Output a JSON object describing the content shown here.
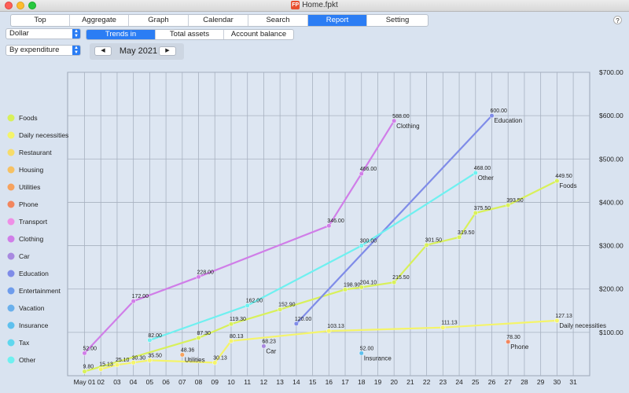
{
  "window": {
    "title": "Home.fpkt",
    "app_icon": "FP",
    "help_label": "?"
  },
  "tabs": [
    {
      "label": "Top"
    },
    {
      "label": "Aggregate"
    },
    {
      "label": "Graph"
    },
    {
      "label": "Calendar"
    },
    {
      "label": "Search"
    },
    {
      "label": "Report",
      "active": true
    },
    {
      "label": "Setting"
    }
  ],
  "currency_select": {
    "value": "Dollar"
  },
  "mode_select": {
    "value": "By expenditure"
  },
  "report_tabs": [
    {
      "label": "Trends in expenditure",
      "active": true
    },
    {
      "label": "Total assets"
    },
    {
      "label": "Account balance"
    }
  ],
  "month_nav": {
    "label": "May 2021",
    "prev": "◀",
    "next": "▶"
  },
  "chart_data": {
    "type": "line",
    "x_categories": [
      "May 01",
      "02",
      "03",
      "04",
      "05",
      "06",
      "07",
      "08",
      "09",
      "10",
      "11",
      "12",
      "13",
      "14",
      "15",
      "16",
      "17",
      "18",
      "19",
      "20",
      "21",
      "22",
      "23",
      "24",
      "25",
      "26",
      "27",
      "28",
      "29",
      "30",
      "31"
    ],
    "y_ticks": [
      "$100.00",
      "$200.00",
      "$300.00",
      "$400.00",
      "$500.00",
      "$600.00",
      "$700.00"
    ],
    "ylim": [
      0,
      700
    ],
    "grid": true,
    "legend_position": "left",
    "legend": [
      {
        "name": "Foods",
        "color": "#d8f05a"
      },
      {
        "name": "Daily necessities",
        "color": "#f4f46a"
      },
      {
        "name": "Restaurant",
        "color": "#f6dc6a"
      },
      {
        "name": "Housing",
        "color": "#f6c163"
      },
      {
        "name": "Utilities",
        "color": "#f6a25e"
      },
      {
        "name": "Phone",
        "color": "#f2865e"
      },
      {
        "name": "Transport",
        "color": "#ef8fe6"
      },
      {
        "name": "Clothing",
        "color": "#d07ee8"
      },
      {
        "name": "Car",
        "color": "#a889e0"
      },
      {
        "name": "Education",
        "color": "#7f8ce8"
      },
      {
        "name": "Entertainment",
        "color": "#6e9cec"
      },
      {
        "name": "Vacation",
        "color": "#6ab0ec"
      },
      {
        "name": "Insurance",
        "color": "#5ec0ee"
      },
      {
        "name": "Tax",
        "color": "#5fd7ee"
      },
      {
        "name": "Other",
        "color": "#6ff0f0"
      }
    ],
    "series": [
      {
        "name": "Foods",
        "color": "#d8f05a",
        "points": [
          {
            "x": 1,
            "y": 9.8,
            "label": "9.80"
          },
          {
            "x": 8,
            "y": 87.3,
            "label": "87.30"
          },
          {
            "x": 10,
            "y": 119.3,
            "label": "119.30"
          },
          {
            "x": 13,
            "y": 152.9,
            "label": "152.90"
          },
          {
            "x": 17,
            "y": 198.9,
            "label": "198.90"
          },
          {
            "x": 18,
            "y": 204.1,
            "label": "204.10"
          },
          {
            "x": 20,
            "y": 215.5,
            "label": "215.50"
          },
          {
            "x": 22,
            "y": 301.5,
            "label": "301.50"
          },
          {
            "x": 24,
            "y": 319.5,
            "label": "319.50"
          },
          {
            "x": 25,
            "y": 375.5,
            "label": "375.50"
          },
          {
            "x": 27,
            "y": 393.5,
            "label": "393.50"
          },
          {
            "x": 30,
            "y": 449.5,
            "label": "449.50"
          }
        ]
      },
      {
        "name": "Daily necessities",
        "color": "#f4f46a",
        "points": [
          {
            "x": 2,
            "y": 15.13,
            "label": "15.13"
          },
          {
            "x": 3,
            "y": 25.1,
            "label": "25.10"
          },
          {
            "x": 4,
            "y": 30.3,
            "label": "30.30"
          },
          {
            "x": 5,
            "y": 35.5,
            "label": "35.50"
          },
          {
            "x": 9,
            "y": 30.13,
            "label": "30.13"
          },
          {
            "x": 10,
            "y": 80.13,
            "label": "80.13"
          },
          {
            "x": 16,
            "y": 103.13,
            "label": "103.13"
          },
          {
            "x": 23,
            "y": 111.13,
            "label": "111.13"
          },
          {
            "x": 30,
            "y": 127.13,
            "label": "127.13"
          }
        ]
      },
      {
        "name": "Utilities",
        "color": "#f6a25e",
        "points": [
          {
            "x": 7,
            "y": 48.36,
            "label": "48.36"
          }
        ]
      },
      {
        "name": "Phone",
        "color": "#f2865e",
        "points": [
          {
            "x": 27,
            "y": 78.3,
            "label": "78.30"
          }
        ]
      },
      {
        "name": "Clothing",
        "color": "#d07ee8",
        "points": [
          {
            "x": 1,
            "y": 52.0,
            "label": "52.00"
          },
          {
            "x": 4,
            "y": 172.0,
            "label": "172.00"
          },
          {
            "x": 8,
            "y": 228.0,
            "label": "228.00"
          },
          {
            "x": 16,
            "y": 346.0,
            "label": "346.00"
          },
          {
            "x": 18,
            "y": 466.0,
            "label": "466.00"
          },
          {
            "x": 20,
            "y": 588.0,
            "label": "588.00"
          }
        ]
      },
      {
        "name": "Car",
        "color": "#a889e0",
        "points": [
          {
            "x": 12,
            "y": 68.23,
            "label": "68.23"
          }
        ]
      },
      {
        "name": "Education",
        "color": "#7f8ce8",
        "points": [
          {
            "x": 14,
            "y": 120.0,
            "label": "120.00"
          },
          {
            "x": 26,
            "y": 600.0,
            "label": "600.00"
          }
        ]
      },
      {
        "name": "Insurance",
        "color": "#5ec0ee",
        "points": [
          {
            "x": 18,
            "y": 52.0,
            "label": "52.00"
          }
        ]
      },
      {
        "name": "Other",
        "color": "#6ff0f0",
        "points": [
          {
            "x": 5,
            "y": 82.0,
            "label": "82.00"
          },
          {
            "x": 11,
            "y": 162.0,
            "label": "162.00"
          },
          {
            "x": 18,
            "y": 300.0,
            "label": "300.00"
          },
          {
            "x": 25,
            "y": 468.0,
            "label": "468.00"
          }
        ]
      }
    ],
    "end_labels": [
      {
        "series": "Clothing",
        "text": "Clothing"
      },
      {
        "series": "Education",
        "text": "Education"
      },
      {
        "series": "Other",
        "text": "Other"
      },
      {
        "series": "Foods",
        "text": "Foods"
      },
      {
        "series": "Daily necessities",
        "text": "Daily necessities"
      },
      {
        "series": "Utilities",
        "text": "Utilities"
      },
      {
        "series": "Phone",
        "text": "Phone"
      },
      {
        "series": "Car",
        "text": "Car"
      },
      {
        "series": "Insurance",
        "text": "Insurance"
      }
    ]
  }
}
